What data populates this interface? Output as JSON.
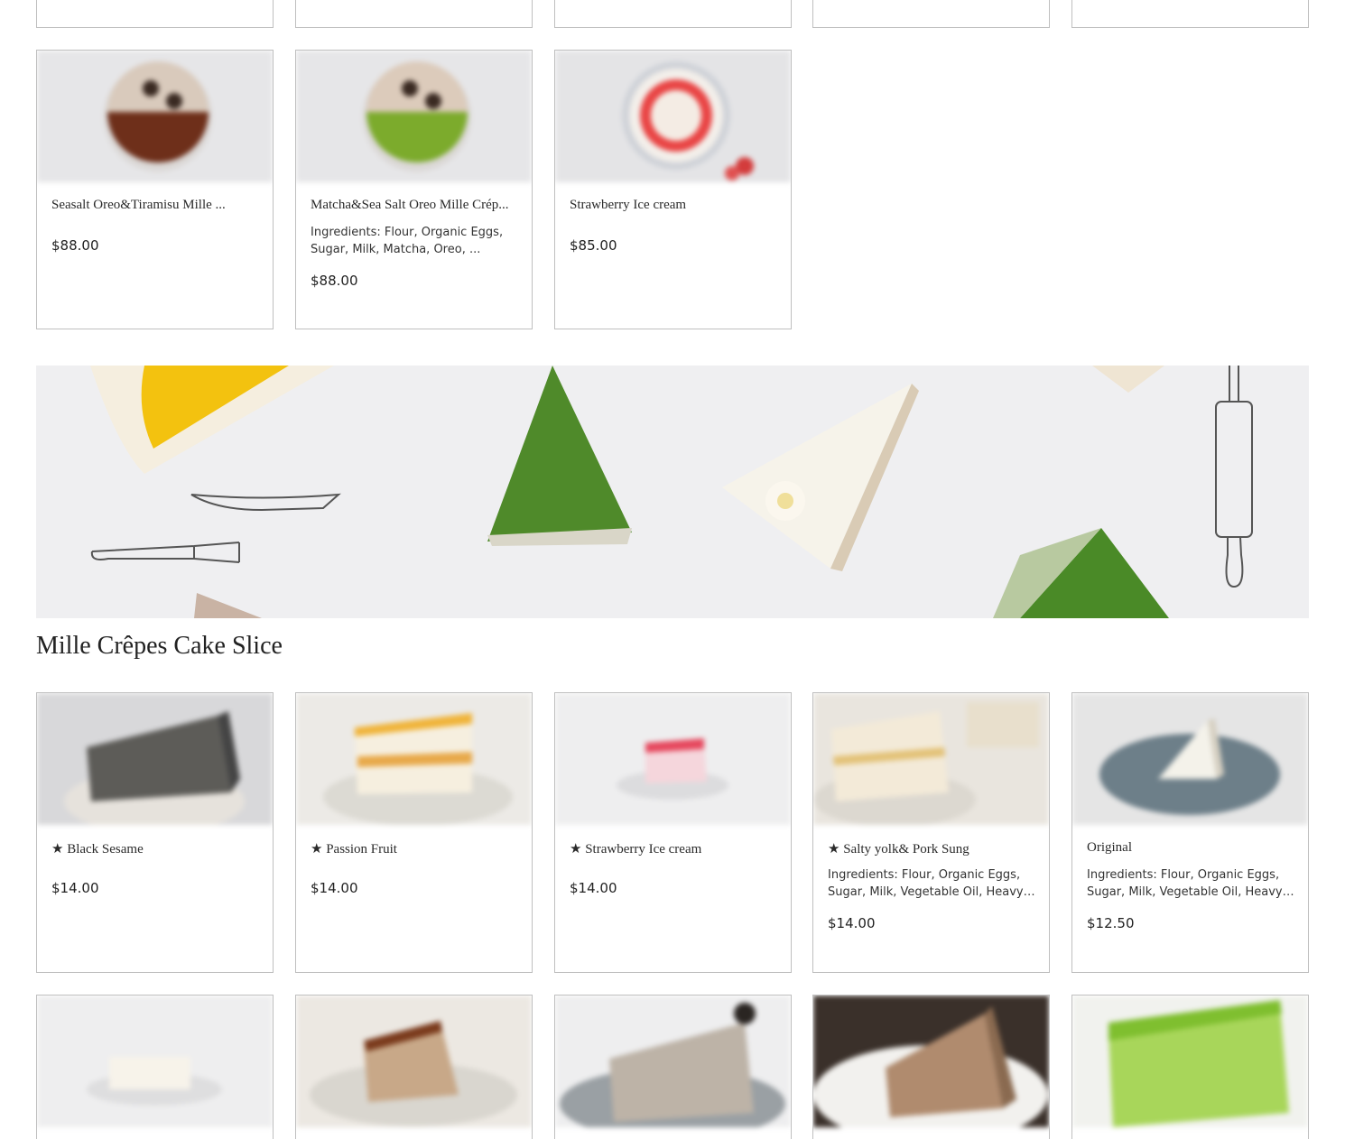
{
  "top_row_cards": [
    {},
    {},
    {},
    {},
    {}
  ],
  "collection_cards": [
    {
      "title": "Seasalt Oreo&Tiramisu Mille ...",
      "description": "",
      "price": "$88.00",
      "thumb_icon": "tiramisu-oreo-crepe-cake-photo"
    },
    {
      "title": "Matcha&Sea Salt Oreo Mille Crép...",
      "description": "Ingredients: Flour, Organic Eggs, Sugar, Milk, Matcha, Oreo, ...",
      "price": "$88.00",
      "thumb_icon": "matcha-oreo-crepe-cake-photo"
    },
    {
      "title": "Strawberry Ice cream",
      "description": "",
      "price": "$85.00",
      "thumb_icon": "strawberry-crepe-cake-photo"
    }
  ],
  "banner": {
    "icon": "crepe-cake-slices-banner",
    "color_matcha": "#4f8a2a",
    "color_mango": "#f3c20f"
  },
  "section": {
    "heading": "Mille Crêpes Cake Slice"
  },
  "slice_cards": [
    {
      "title": "★ Black Sesame",
      "description": "",
      "price": "$14.00",
      "thumb_icon": "black-sesame-slice-photo"
    },
    {
      "title": "★ Passion Fruit",
      "description": "",
      "price": "$14.00",
      "thumb_icon": "passion-fruit-slice-photo"
    },
    {
      "title": "★ Strawberry Ice cream",
      "description": "",
      "price": "$14.00",
      "thumb_icon": "strawberry-slice-photo"
    },
    {
      "title": "★ Salty yolk& Pork Sung",
      "description": "Ingredients: Flour, Organic Eggs, Sugar, Milk, Vegetable Oil, Heavy ...",
      "price": "$14.00",
      "thumb_icon": "salty-yolk-slice-photo"
    },
    {
      "title": "Original",
      "description": "Ingredients: Flour, Organic Eggs, Sugar, Milk, Vegetable Oil, Heavy ...",
      "price": "$12.50",
      "thumb_icon": "original-slice-photo"
    }
  ],
  "bottom_row_cards": [
    {
      "thumb_icon": "vanilla-slice-photo"
    },
    {
      "thumb_icon": "tiramisu-slice-photo"
    },
    {
      "thumb_icon": "oreo-slice-photo"
    },
    {
      "thumb_icon": "chocolate-slice-photo"
    },
    {
      "thumb_icon": "matcha-slice-photo"
    }
  ]
}
